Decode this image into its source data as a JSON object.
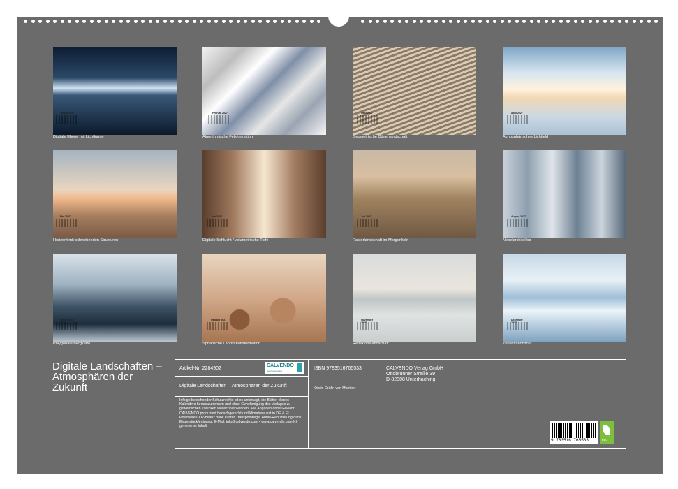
{
  "months": [
    {
      "mini": "Januar 2027",
      "caption": "Digitale Ebene mit Lichtkante"
    },
    {
      "mini": "Februar 2027",
      "caption": "Algorithmische Felsformation"
    },
    {
      "mini": "März 2027",
      "caption": "Geometrische Dünenlandschaft"
    },
    {
      "mini": "April 2027",
      "caption": "Atmosphärisches Lichtfeld"
    },
    {
      "mini": "Mai 2027",
      "caption": "Horizont mit schwebenden Strukturen"
    },
    {
      "mini": "Juni 2027",
      "caption": "Digitale Schlucht / volumetrische Tiefe"
    },
    {
      "mini": "Juli 2027",
      "caption": "Rasterlandschaft im Morgenlicht"
    },
    {
      "mini": "August 2027",
      "caption": "Nebelarchitektur"
    },
    {
      "mini": "September 2027",
      "caption": "Polygonale Bergkette"
    },
    {
      "mini": "Oktober 2027",
      "caption": "Sphärische Landschaftsformation"
    },
    {
      "mini": "November 2027",
      "caption": "Reflexionslandschaft"
    },
    {
      "mini": "Dezember 2027",
      "caption": "Zukunftshorizont"
    }
  ],
  "cover_title": "Digitale Landschaften – Atmosphären der Zukunft",
  "info": {
    "article": "Artikel-Nr. 2284902",
    "logo": "CALVENDO",
    "logo_sub": "Dein Kalendarium",
    "book_title": "Digitale Landschaften – Atmosphären der Zukunft",
    "notice": "Infolge bestehender Schutzrechte ist es untersagt, die Blätter dieses Kalenders herauszutrennen und ohne Genehmigung des Verlages zu gewerblichen Zwecken weiterzuverwenden. Alle Angaben ohne Gewähr. CALVENDO produziert bedarfsgerecht und klimabewusst in DE & EU. Positivere CO2-Bilanz dank kurzer Transportwege. Abfall-Reduzierung dank Einzelstückfertigung. E-Mail: info@calvendo.com • www.calvendo.com KI-generierter Inhalt",
    "isbn": "ISBN 9783516765533",
    "author": "Kristin Gräfin von Montfort",
    "publisher_name": "CALVENDO Verlag GmbH",
    "publisher_street": "Ottobrunner Straße 39",
    "publisher_city": "D-82008 Unterhaching",
    "barcode": "9 783516 765533",
    "eco": "eco"
  },
  "colors": {
    "background": "#6b6b6b",
    "text": "#ffffff",
    "accent": "#2aa3a8",
    "eco": "#7cbf3f"
  }
}
